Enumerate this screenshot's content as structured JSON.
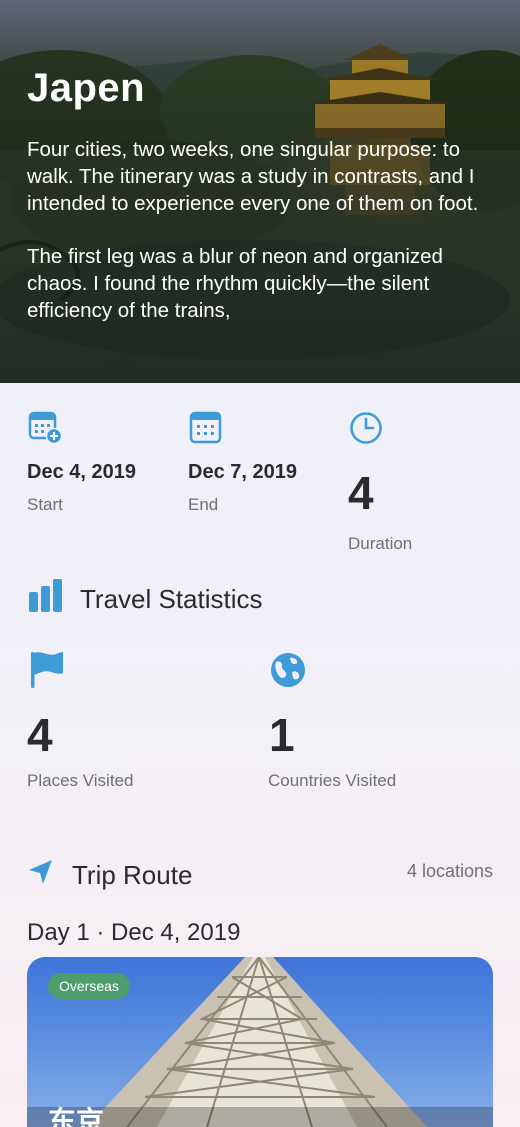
{
  "trip": {
    "title": "Japen",
    "paragraphs": [
      "Four cities, two weeks, one singular purpose: to walk. The itinerary was a study in contrasts, and I intended to experience every one of them on foot.",
      "The first leg was a blur of neon and organized chaos. I found the rhythm quickly—the silent efficiency of the trains,"
    ]
  },
  "dates": {
    "start": {
      "value": "Dec 4, 2019",
      "label": "Start",
      "icon": "calendar-add-icon"
    },
    "end": {
      "value": "Dec 7, 2019",
      "label": "End",
      "icon": "calendar-icon"
    },
    "duration": {
      "value": "4",
      "label": "Duration",
      "icon": "clock-icon"
    }
  },
  "stats": {
    "title": "Travel Statistics",
    "icon": "bar-chart-icon",
    "places": {
      "value": "4",
      "label": "Places Visited",
      "icon": "flag-icon"
    },
    "countries": {
      "value": "1",
      "label": "Countries Visited",
      "icon": "globe-icon"
    }
  },
  "route": {
    "title": "Trip Route",
    "icon": "location-arrow-icon",
    "count_label": "4 locations",
    "day_header": "Day 1 · Dec 4, 2019",
    "card": {
      "badge": "Overseas",
      "title": "东京"
    }
  },
  "colors": {
    "accent": "#3f9ad8",
    "text": "#2b2b2f",
    "muted": "#6f6f75",
    "badge": "#4e9d6c"
  }
}
